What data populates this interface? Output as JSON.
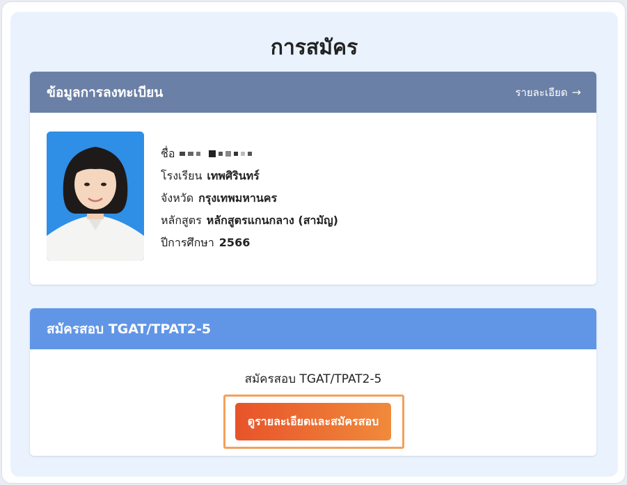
{
  "page": {
    "title": "การสมัคร"
  },
  "registration": {
    "header": "ข้อมูลการลงทะเบียน",
    "detail_link": "รายละเอียด",
    "rows": [
      {
        "label": "ชื่อ",
        "value": ""
      },
      {
        "label": "โรงเรียน",
        "value": "เทพศิรินทร์"
      },
      {
        "label": "จังหวัด",
        "value": "กรุงเทพมหานคร"
      },
      {
        "label": "หลักสูตร",
        "value": "หลักสูตรแกนกลาง (สามัญ)"
      },
      {
        "label": "ปีการศึกษา",
        "value": "2566"
      }
    ]
  },
  "apply": {
    "header": "สมัครสอบ TGAT/TPAT2-5",
    "text": "สมัครสอบ TGAT/TPAT2-5",
    "button": "ดูรายละเอียดและสมัครสอบ"
  },
  "colors": {
    "registration_header": "#6b80a6",
    "apply_header": "#6196e6",
    "button_start": "#e8532a",
    "button_end": "#f08a3b",
    "highlight_frame": "#f4a05a",
    "panel_bg": "#eaf3fd"
  },
  "icons": {
    "detail_arrow": "arrow-right-icon"
  }
}
